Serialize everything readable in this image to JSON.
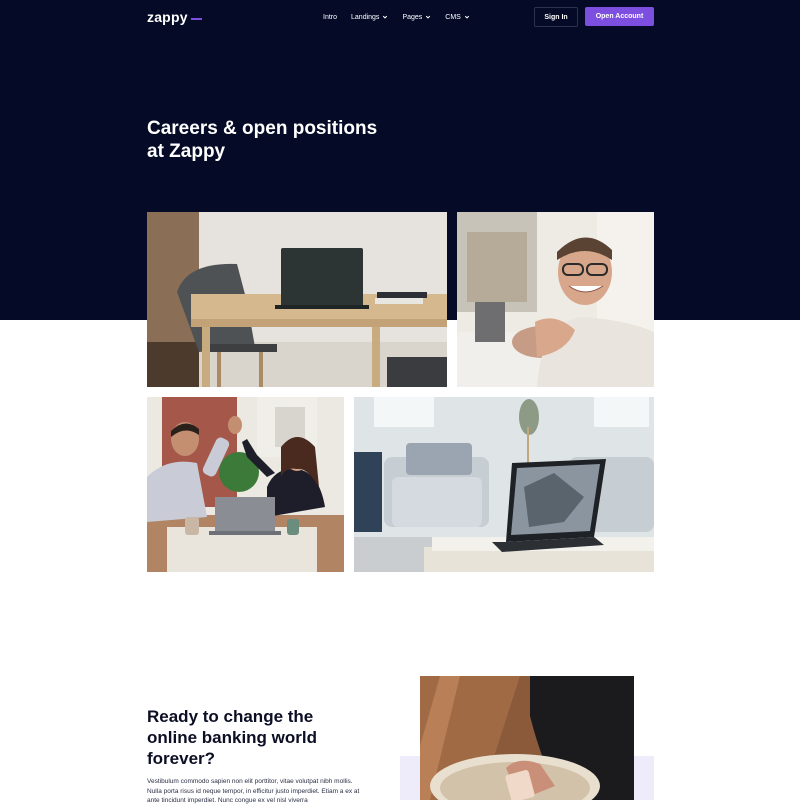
{
  "nav": {
    "logo": "zappy",
    "items": [
      {
        "label": "Intro",
        "has_dropdown": false
      },
      {
        "label": "Landings",
        "has_dropdown": true
      },
      {
        "label": "Pages",
        "has_dropdown": true
      },
      {
        "label": "CMS",
        "has_dropdown": true
      }
    ],
    "sign_in": "Sign In",
    "open_account": "Open Account"
  },
  "hero": {
    "title_line1": "Careers & open positions",
    "title_line2": "at Zappy"
  },
  "cta": {
    "title_line1": "Ready to change the",
    "title_line2": "online banking world",
    "title_line3": "forever?",
    "body": "Vestibulum commodo sapien non elit porttitor, vitae volutpat nibh mollis. Nulla porta risus id neque tempor, in efficitur justo imperdiet. Etiam a ex at ante tincidunt imperdiet. Nunc congue ex vel nisl viverra"
  },
  "colors": {
    "hero_bg": "#050b27",
    "accent": "#7d4fe0",
    "heading": "#0c0f24",
    "lavender": "#eeecfb"
  }
}
